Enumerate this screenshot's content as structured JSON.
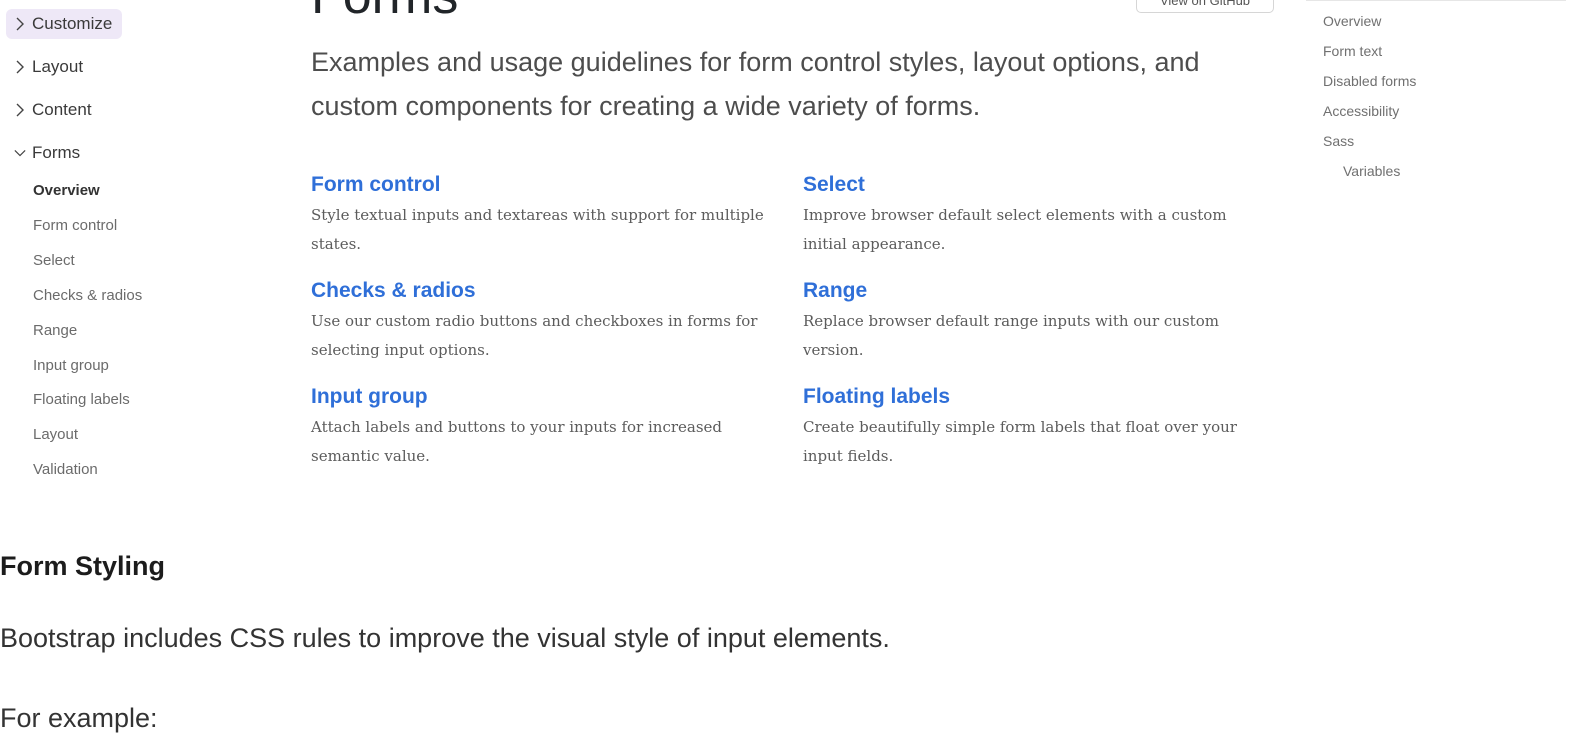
{
  "sidebar": {
    "groups": [
      {
        "label": "Customize",
        "expanded": false,
        "active": true
      },
      {
        "label": "Layout",
        "expanded": false,
        "active": false
      },
      {
        "label": "Content",
        "expanded": false,
        "active": false
      },
      {
        "label": "Forms",
        "expanded": true,
        "active": false
      }
    ],
    "forms_items": [
      {
        "label": "Overview",
        "current": true
      },
      {
        "label": "Form control",
        "current": false
      },
      {
        "label": "Select",
        "current": false
      },
      {
        "label": "Checks & radios",
        "current": false
      },
      {
        "label": "Range",
        "current": false
      },
      {
        "label": "Input group",
        "current": false
      },
      {
        "label": "Floating labels",
        "current": false
      },
      {
        "label": "Layout",
        "current": false
      },
      {
        "label": "Validation",
        "current": false
      }
    ]
  },
  "main": {
    "title": "Forms",
    "view_button": "View on GitHub",
    "lead": "Examples and usage guidelines for form control styles, layout options, and custom components for creating a wide variety of forms.",
    "cards": [
      {
        "title": "Form control",
        "desc": "Style textual inputs and textareas with support for multiple states."
      },
      {
        "title": "Select",
        "desc": "Improve browser default select elements with a custom initial appearance."
      },
      {
        "title": "Checks & radios",
        "desc": "Use our custom radio buttons and checkboxes in forms for selecting input options."
      },
      {
        "title": "Range",
        "desc": "Replace browser default range inputs with our custom version."
      },
      {
        "title": "Input group",
        "desc": "Attach labels and buttons to your inputs for increased semantic value."
      },
      {
        "title": "Floating labels",
        "desc": "Create beautifully simple form labels that float over your input fields."
      }
    ]
  },
  "toc": {
    "items": [
      {
        "label": "Overview",
        "sub": false
      },
      {
        "label": "Form text",
        "sub": false
      },
      {
        "label": "Disabled forms",
        "sub": false
      },
      {
        "label": "Accessibility",
        "sub": false
      },
      {
        "label": "Sass",
        "sub": false
      },
      {
        "label": "Variables",
        "sub": true
      }
    ]
  },
  "article": {
    "heading": "Form Styling",
    "p1": "Bootstrap includes CSS rules to improve the visual style of input elements.",
    "p2": "For example:"
  },
  "colors": {
    "link": "#2f6fd8",
    "active_nav_bg": "#eee8f7"
  },
  "icons": {
    "collapsed": "chevron-right-icon",
    "expanded": "chevron-down-icon"
  }
}
